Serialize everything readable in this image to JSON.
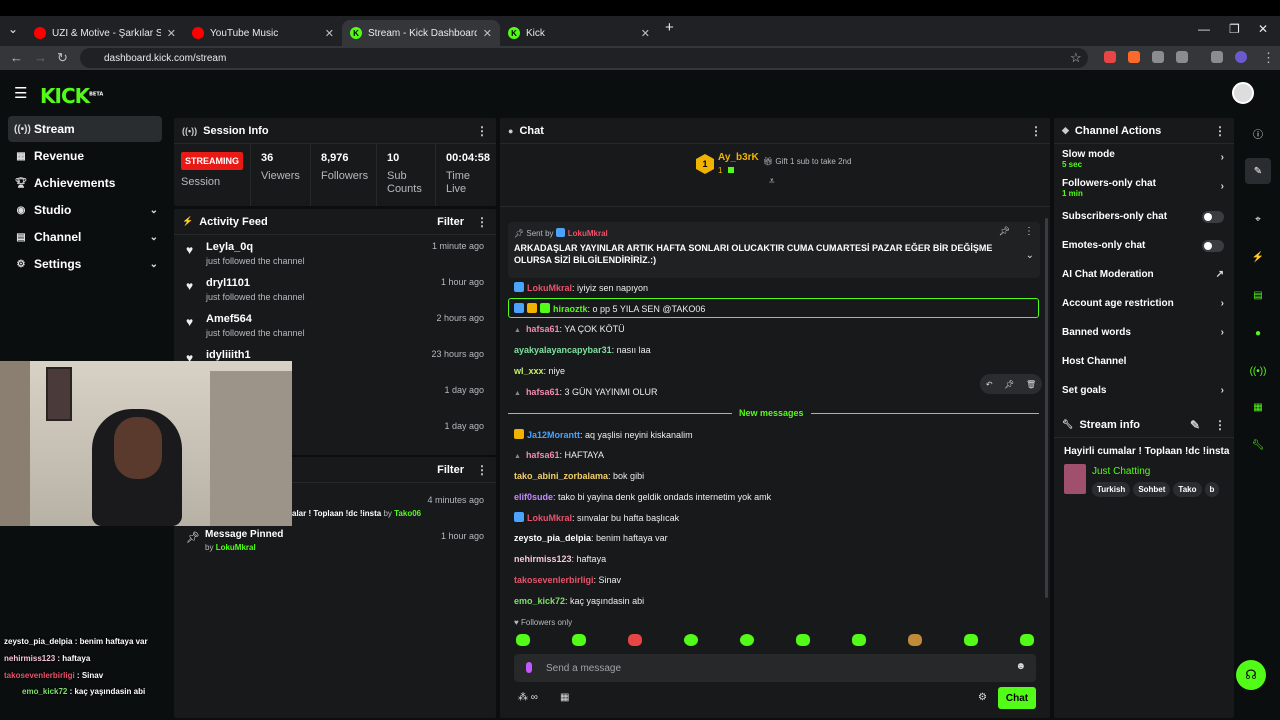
{
  "browser": {
    "tabs": [
      {
        "label": "UZI & Motive - Şarkılar Sokakla",
        "icon_color": "#ff0000"
      },
      {
        "label": "YouTube Music",
        "icon_color": "#ff0000"
      },
      {
        "label": "Stream - Kick Dashboard",
        "icon_color": "#53fc18"
      },
      {
        "label": "Kick",
        "icon_color": "#53fc18"
      }
    ],
    "url": "dashboard.kick.com/stream"
  },
  "brand": {
    "logo": "KICK",
    "beta": "BETA",
    "accent": "#53fc18"
  },
  "sidebar": {
    "items": [
      {
        "label": "Stream",
        "icon": "stream-icon"
      },
      {
        "label": "Revenue",
        "icon": "revenue-icon"
      },
      {
        "label": "Achievements",
        "icon": "trophy-icon"
      },
      {
        "label": "Studio",
        "icon": "studio-icon"
      },
      {
        "label": "Channel",
        "icon": "channel-icon"
      },
      {
        "label": "Settings",
        "icon": "gear-icon"
      }
    ]
  },
  "session": {
    "title": "Session Info",
    "status": "STREAMING",
    "status_label": "Session",
    "stats": [
      {
        "value": "36",
        "label": "Viewers"
      },
      {
        "value": "8,976",
        "label": "Followers"
      },
      {
        "value": "10",
        "label": "Sub Counts"
      },
      {
        "value": "00:04:58",
        "label": "Time Live"
      }
    ]
  },
  "activity": {
    "title": "Activity Feed",
    "filter": "Filter",
    "items": [
      {
        "name": "Leyla_0q",
        "desc": "just followed the channel",
        "time": "1 minute ago"
      },
      {
        "name": "dryl1101",
        "desc": "just followed the channel",
        "time": "1 hour ago"
      },
      {
        "name": "Amef564",
        "desc": "just followed the channel",
        "time": "2 hours ago"
      },
      {
        "name": "idyliiith1",
        "desc": "nel",
        "time": "23 hours ago"
      },
      {
        "name": "",
        "desc": "",
        "time": "1 day ago"
      },
      {
        "name": "",
        "desc": "",
        "time": "1 day ago"
      }
    ]
  },
  "events": {
    "filter": "Filter",
    "item1": {
      "desc": "alar ! Toplaan !dc !insta",
      "by": "by",
      "user": "Tako06",
      "time": "4 minutes ago"
    },
    "item2": {
      "title": "Message Pinned",
      "by": "by",
      "user": "LokuMkral",
      "time": "1 hour ago"
    }
  },
  "chat": {
    "title": "Chat",
    "gifter": {
      "name": "Ay_b3rK",
      "count": "1",
      "rank": "1"
    },
    "gift_text": "Gift 1 sub to take 2nd",
    "pinned": {
      "sent_by": "Sent by",
      "user": "LokuMkral",
      "text": "ARKADAŞLAR YAYINLAR ARTIK HAFTA SONLARI OLUCAKTIR CUMA CUMARTESİ PAZAR EĞER BİR DEĞİŞME OLURSA SİZİ BİLGİLENDİRİRİZ.:)"
    },
    "messages": [
      {
        "user": "LokuMkral",
        "text": ": iyiyiz sen napıyon",
        "color": "#e8536b"
      },
      {
        "user": "hiraoztk",
        "text": ": o pp 5 YILA SEN @TAKO06",
        "color": "#53fc18"
      },
      {
        "user": "hafsa61",
        "text": ": YA ÇOK KÖTÜ",
        "color": "#f08bb0"
      },
      {
        "user": "ayakyalayancapybar31",
        "text": ": nasıı laa",
        "color": "#7ee0a0"
      },
      {
        "user": "wl_xxx",
        "text": ": niye",
        "color": "#c6f06b"
      },
      {
        "user": "hafsa61",
        "text": ": 3 GÜN YAYINMI OLUR",
        "color": "#f08bb0"
      },
      {
        "user": "Ja12Morantt",
        "text": ": aq yaşlisi neyini kiskanalim",
        "color": "#4aa3ff"
      },
      {
        "user": "hafsa61",
        "text": ": HAFTAYA",
        "color": "#f08bb0"
      },
      {
        "user": "tako_abini_zorbalama",
        "text": ": bok gibi",
        "color": "#f0d06b"
      },
      {
        "user": "elif0sude",
        "text": ": tako bi yayina denk geldik ondads internetim yok amk",
        "color": "#c48bff"
      },
      {
        "user": "LokuMkral",
        "text": ": sınvalar bu hafta başlıcak",
        "color": "#e8536b"
      },
      {
        "user": "zeysto_pia_delpia",
        "text": ": benim haftaya var",
        "color": "#ffffff"
      },
      {
        "user": "nehirmiss123",
        "text": ": haftaya",
        "color": "#f5c6d8"
      },
      {
        "user": "takosevenlerbirligi",
        "text": ": Sinav",
        "color": "#e8536b"
      },
      {
        "user": "emo_kick72",
        "text": ": kaç yaşındasin abi",
        "color": "#7ee06b"
      }
    ],
    "new_messages": "New messages",
    "followers_only": "Followers only",
    "input_placeholder": "Send a message",
    "send_label": "Chat"
  },
  "channel_actions": {
    "title": "Channel Actions",
    "items": [
      {
        "label": "Slow mode",
        "sub": "5 sec"
      },
      {
        "label": "Followers-only chat",
        "sub": "1 min"
      },
      {
        "label": "Subscribers-only chat",
        "sub": ""
      },
      {
        "label": "Emotes-only chat",
        "sub": ""
      },
      {
        "label": "AI Chat Moderation",
        "sub": ""
      },
      {
        "label": "Account age restriction",
        "sub": ""
      },
      {
        "label": "Banned words",
        "sub": ""
      },
      {
        "label": "Host Channel",
        "sub": ""
      },
      {
        "label": "Set goals",
        "sub": ""
      }
    ]
  },
  "stream_info": {
    "title": "Stream info",
    "stream_title": "Hayirli cumalar ! Toplaan !dc !insta",
    "category": "Just Chatting",
    "tags": [
      "Turkish",
      "Sohbet",
      "Tako",
      "b"
    ]
  },
  "overlay_chat": [
    {
      "user": "zeysto_pia_delpia",
      "text": " : benim haftaya var",
      "color": "#ffffff"
    },
    {
      "user": "nehirmiss123",
      "text": " : haftaya",
      "color": "#f5c6d8"
    },
    {
      "user": "takosevenlerbirligi",
      "text": " : Sinav",
      "color": "#e8536b"
    },
    {
      "user": "emo_kick72",
      "text": " : kaç yaşındasin abi",
      "color": "#7ee06b"
    }
  ]
}
